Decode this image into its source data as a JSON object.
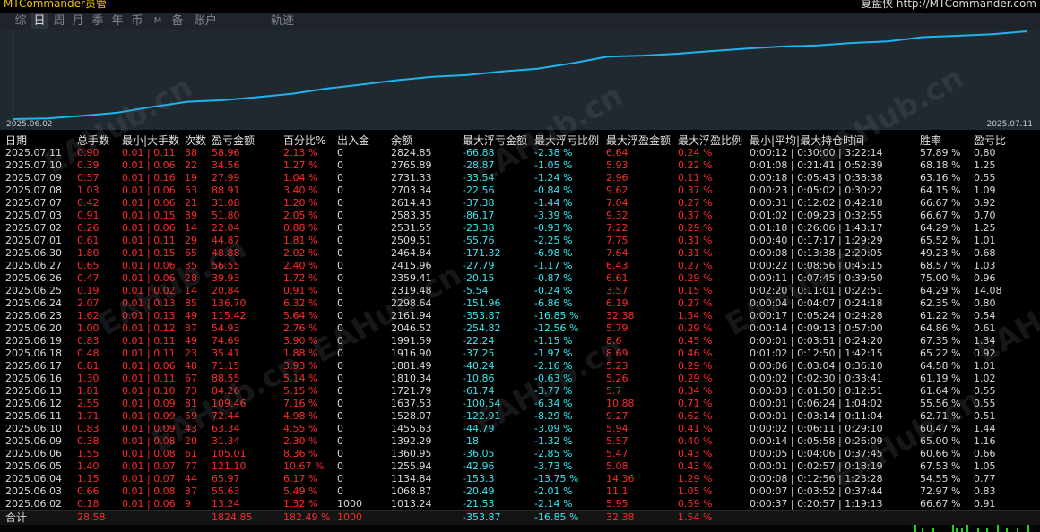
{
  "header": {
    "app_title": "MTCommander员管",
    "right_text": "复盘侠 http://MTCommander.com"
  },
  "tabs": [
    {
      "label": "综",
      "active": false
    },
    {
      "label": "日",
      "active": true
    },
    {
      "label": "周",
      "active": false
    },
    {
      "label": "月",
      "active": false
    },
    {
      "label": "季",
      "active": false
    },
    {
      "label": "年",
      "active": false
    },
    {
      "label": "币",
      "active": false
    },
    {
      "label": "M",
      "active": false
    },
    {
      "label": "备",
      "active": false
    },
    {
      "label": "账户",
      "active": false
    },
    {
      "label": "轨迹",
      "active": false
    }
  ],
  "chart": {
    "start_date": "2025.06.02",
    "end_date": "2025.07.11",
    "line_color": "#1fb4f0"
  },
  "watermark": "EAHub.cn",
  "columns": [
    "日期",
    "总手数",
    "最小|大手数",
    "次数",
    "盈亏金额",
    "百分比%",
    "出入金",
    "余额",
    "最大浮亏金额",
    "最大浮亏比例",
    "最大浮盈金额",
    "最大浮盈比例",
    "最小|平均|最大持仓时间",
    "胜率",
    "盈亏比"
  ],
  "rows": [
    [
      "2025.07.11",
      "0.90",
      "0.01 | 0.11",
      "38",
      "58.96",
      "2.13 %",
      "0",
      "2824.85",
      "-66.88",
      "-2.38 %",
      "6.64",
      "0.24 %",
      "0:00:12 | 0:30:00 | 3:22:14",
      "57.89 %",
      "0.80"
    ],
    [
      "2025.07.10",
      "0.39",
      "0.01 | 0.06",
      "22",
      "34.56",
      "1.27 %",
      "0",
      "2765.89",
      "-28.87",
      "-1.05 %",
      "5.93",
      "0.22 %",
      "0:01:08 | 0:21:41 | 0:52:39",
      "68.18 %",
      "1.25"
    ],
    [
      "2025.07.09",
      "0.57",
      "0.01 | 0.16",
      "19",
      "27.99",
      "1.04 %",
      "0",
      "2731.33",
      "-33.54",
      "-1.24 %",
      "2.96",
      "0.11 %",
      "0:00:18 | 0:05:43 | 0:38:38",
      "63.16 %",
      "0.55"
    ],
    [
      "2025.07.08",
      "1.03",
      "0.01 | 0.06",
      "53",
      "88.91",
      "3.40 %",
      "0",
      "2703.34",
      "-22.56",
      "-0.84 %",
      "9.62",
      "0.37 %",
      "0:00:23 | 0:05:02 | 0:30:22",
      "64.15 %",
      "1.09"
    ],
    [
      "2025.07.07",
      "0.42",
      "0.01 | 0.06",
      "21",
      "31.08",
      "1.20 %",
      "0",
      "2614.43",
      "-37.38",
      "-1.44 %",
      "7.04",
      "0.27 %",
      "0:00:31 | 0:12:02 | 0:42:18",
      "66.67 %",
      "0.92"
    ],
    [
      "2025.07.03",
      "0.91",
      "0.01 | 0.15",
      "39",
      "51.80",
      "2.05 %",
      "0",
      "2583.35",
      "-86.17",
      "-3.39 %",
      "9.32",
      "0.37 %",
      "0:01:02 | 0:09:23 | 0:32:55",
      "66.67 %",
      "0.70"
    ],
    [
      "2025.07.02",
      "0.26",
      "0.01 | 0.06",
      "14",
      "22.04",
      "0.88 %",
      "0",
      "2531.55",
      "-23.38",
      "-0.93 %",
      "7.22",
      "0.29 %",
      "0:01:18 | 0:26:06 | 1:43:17",
      "64.29 %",
      "1.25"
    ],
    [
      "2025.07.01",
      "0.61",
      "0.01 | 0.11",
      "29",
      "44.87",
      "1.81 %",
      "0",
      "2509.51",
      "-55.76",
      "-2.25 %",
      "7.75",
      "0.31 %",
      "0:00:40 | 0:17:17 | 1:29:29",
      "65.52 %",
      "1.01"
    ],
    [
      "2025.06.30",
      "1.80",
      "0.01 | 0.15",
      "65",
      "48.88",
      "2.02 %",
      "0",
      "2464.84",
      "-171.32",
      "-6.98 %",
      "7.64",
      "0.31 %",
      "0:00:08 | 0:13:38 | 2:20:05",
      "49.23 %",
      "0.68"
    ],
    [
      "2025.06.27",
      "0.65",
      "0.01 | 0.06",
      "35",
      "56.55",
      "2.40 %",
      "0",
      "2415.96",
      "-27.79",
      "-1.17 %",
      "6.43",
      "0.27 %",
      "0:00:22 | 0:08:56 | 0:45:15",
      "68.57 %",
      "1.03"
    ],
    [
      "2025.06.26",
      "0.47",
      "0.01 | 0.06",
      "28",
      "39.93",
      "1.72 %",
      "0",
      "2359.41",
      "-20.15",
      "-0.87 %",
      "6.61",
      "0.29 %",
      "0:00:11 | 0:07:45 | 0:39:50",
      "75.00 %",
      "0.96"
    ],
    [
      "2025.06.25",
      "0.19",
      "0.01 | 0.02",
      "14",
      "20.84",
      "0.91 %",
      "0",
      "2319.48",
      "-5.54",
      "-0.24 %",
      "3.57",
      "0.15 %",
      "0:02:20 | 0:11:01 | 0:22:51",
      "64.29 %",
      "14.08"
    ],
    [
      "2025.06.24",
      "2.07",
      "0.01 | 0.13",
      "85",
      "136.70",
      "6.32 %",
      "0",
      "2298.64",
      "-151.96",
      "-6.86 %",
      "6.19",
      "0.27 %",
      "0:00:04 | 0:04:07 | 0:24:18",
      "62.35 %",
      "0.80"
    ],
    [
      "2025.06.23",
      "1.62",
      "0.01 | 0.13",
      "49",
      "115.42",
      "5.64 %",
      "0",
      "2161.94",
      "-353.87",
      "-16.85 %",
      "32.38",
      "1.54 %",
      "0:00:17 | 0:05:24 | 0:24:28",
      "61.22 %",
      "0.54"
    ],
    [
      "2025.06.20",
      "1.00",
      "0.01 | 0.12",
      "37",
      "54.93",
      "2.76 %",
      "0",
      "2046.52",
      "-254.82",
      "-12.56 %",
      "5.79",
      "0.29 %",
      "0:00:14 | 0:09:13 | 0:57:00",
      "64.86 %",
      "0.61"
    ],
    [
      "2025.06.19",
      "0.83",
      "0.01 | 0.11",
      "49",
      "74.69",
      "3.90 %",
      "0",
      "1991.59",
      "-22.24",
      "-1.15 %",
      "8.6",
      "0.45 %",
      "0:00:01 | 0:03:51 | 0:24:20",
      "67.35 %",
      "1.34"
    ],
    [
      "2025.06.18",
      "0.48",
      "0.01 | 0.11",
      "23",
      "35.41",
      "1.88 %",
      "0",
      "1916.90",
      "-37.25",
      "-1.97 %",
      "8.69",
      "0.46 %",
      "0:01:02 | 0:12:50 | 1:42:15",
      "65.22 %",
      "0.92"
    ],
    [
      "2025.06.17",
      "0.81",
      "0.01 | 0.06",
      "48",
      "71.15",
      "3.93 %",
      "0",
      "1881.49",
      "-40.24",
      "-2.16 %",
      "5.23",
      "0.29 %",
      "0:00:06 | 0:03:04 | 0:36:10",
      "64.58 %",
      "1.01"
    ],
    [
      "2025.06.16",
      "1.30",
      "0.01 | 0.11",
      "67",
      "88.55",
      "5.14 %",
      "0",
      "1810.34",
      "-10.86",
      "-0.63 %",
      "5.26",
      "0.29 %",
      "0:00:02 | 0:02:30 | 0:33:41",
      "61.19 %",
      "1.02"
    ],
    [
      "2025.06.13",
      "1.81",
      "0.01 | 0.10",
      "73",
      "84.26",
      "5.15 %",
      "0",
      "1721.79",
      "-61.74",
      "-3.77 %",
      "5.7",
      "0.34 %",
      "0:00:03 | 0:01:50 | 0:12:51",
      "61.64 %",
      "0.55"
    ],
    [
      "2025.06.12",
      "2.55",
      "0.01 | 0.09",
      "81",
      "109.46",
      "7.16 %",
      "0",
      "1637.53",
      "-100.54",
      "-6.34 %",
      "10.88",
      "0.71 %",
      "0:00:01 | 0:06:24 | 1:04:02",
      "55.56 %",
      "0.55"
    ],
    [
      "2025.06.11",
      "1.71",
      "0.01 | 0.09",
      "59",
      "72.44",
      "4.98 %",
      "0",
      "1528.07",
      "-122.91",
      "-8.29 %",
      "9.27",
      "0.62 %",
      "0:00:01 | 0:03:14 | 0:11:04",
      "62.71 %",
      "0.51"
    ],
    [
      "2025.06.10",
      "0.83",
      "0.01 | 0.09",
      "43",
      "63.34",
      "4.55 %",
      "0",
      "1455.63",
      "-44.79",
      "-3.09 %",
      "5.94",
      "0.41 %",
      "0:00:02 | 0:06:11 | 0:29:10",
      "60.47 %",
      "1.44"
    ],
    [
      "2025.06.09",
      "0.38",
      "0.01 | 0.08",
      "20",
      "31.34",
      "2.30 %",
      "0",
      "1392.29",
      "-18",
      "-1.32 %",
      "5.57",
      "0.40 %",
      "0:00:14 | 0:05:58 | 0:26:09",
      "65.00 %",
      "1.16"
    ],
    [
      "2025.06.06",
      "1.55",
      "0.01 | 0.08",
      "61",
      "105.01",
      "8.36 %",
      "0",
      "1360.95",
      "-36.05",
      "-2.85 %",
      "5.47",
      "0.43 %",
      "0:00:05 | 0:04:06 | 0:37:45",
      "60.66 %",
      "0.66"
    ],
    [
      "2025.06.05",
      "1.40",
      "0.01 | 0.07",
      "77",
      "121.10",
      "10.67 %",
      "0",
      "1255.94",
      "-42.96",
      "-3.73 %",
      "5.08",
      "0.43 %",
      "0:00:01 | 0:02:57 | 0:18:19",
      "67.53 %",
      "1.05"
    ],
    [
      "2025.06.04",
      "1.15",
      "0.01 | 0.07",
      "44",
      "65.97",
      "6.17 %",
      "0",
      "1134.84",
      "-153.3",
      "-13.75 %",
      "14.36",
      "1.29 %",
      "0:00:08 | 0:12:56 | 1:23:28",
      "54.55 %",
      "0.77"
    ],
    [
      "2025.06.03",
      "0.66",
      "0.01 | 0.08",
      "37",
      "55.63",
      "5.49 %",
      "0",
      "1068.87",
      "-20.49",
      "-2.01 %",
      "11.1",
      "1.05 %",
      "0:00:07 | 0:03:52 | 0:37:44",
      "72.97 %",
      "0.83"
    ],
    [
      "2025.06.02",
      "0.18",
      "0.01 | 0.06",
      "9",
      "13.24",
      "1.32 %",
      "1000",
      "1013.24",
      "-21.53",
      "-2.14 %",
      "5.95",
      "0.59 %",
      "0:00:37 | 0:20:57 | 1:19:13",
      "66.67 %",
      "0.91"
    ]
  ],
  "totals": {
    "label": "合计",
    "lots": "28.58",
    "pnl": "1824.85",
    "pct": "182.49 %",
    "deposit": "1000",
    "max_float_loss": "-353.87",
    "max_float_loss_pct": "-16.85 %",
    "max_float_profit": "32.38",
    "max_float_profit_pct": "1.54 %"
  }
}
